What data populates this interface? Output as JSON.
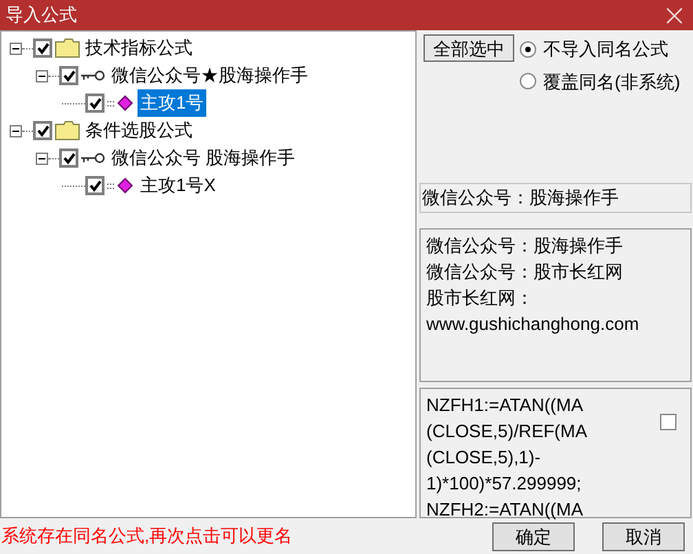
{
  "window": {
    "title": "导入公式"
  },
  "tree": [
    {
      "label": "技术指标公式",
      "kind": "folder",
      "checked": true,
      "expanded": true,
      "selected": false,
      "children": [
        {
          "label": "微信公众号★股海操作手",
          "kind": "group",
          "checked": true,
          "expanded": true,
          "selected": false,
          "children": [
            {
              "label": "主攻1号",
              "kind": "formula",
              "checked": true,
              "selected": true
            }
          ]
        }
      ]
    },
    {
      "label": "条件选股公式",
      "kind": "folder",
      "checked": true,
      "expanded": true,
      "selected": false,
      "children": [
        {
          "label": "微信公众号 股海操作手",
          "kind": "group",
          "checked": true,
          "expanded": true,
          "selected": false,
          "children": [
            {
              "label": "主攻1号X",
              "kind": "formula",
              "checked": true,
              "selected": false
            }
          ]
        }
      ]
    }
  ],
  "select_all_button": "全部选中",
  "options": [
    {
      "label": "不导入同名公式",
      "selected": true
    },
    {
      "label": "覆盖同名(非系统)",
      "selected": false
    }
  ],
  "name_field": "微信公众号：股海操作手",
  "description_lines": [
    "微信公众号：股海操作手",
    "微信公众号：股市长红网",
    "股市长红网：",
    "www.gushichanghong.com"
  ],
  "formula_lines": [
    "NZFH1:=ATAN((MA",
    "(CLOSE,5)/REF(MA",
    "(CLOSE,5),1)-",
    "1)*100)*57.299999;",
    "NZFH2:=ATAN((MA"
  ],
  "formula_checkbox": {
    "checked": false
  },
  "status_message": "系统存在同名公式,再次点击可以更名",
  "buttons": [
    "确定",
    "取消"
  ]
}
